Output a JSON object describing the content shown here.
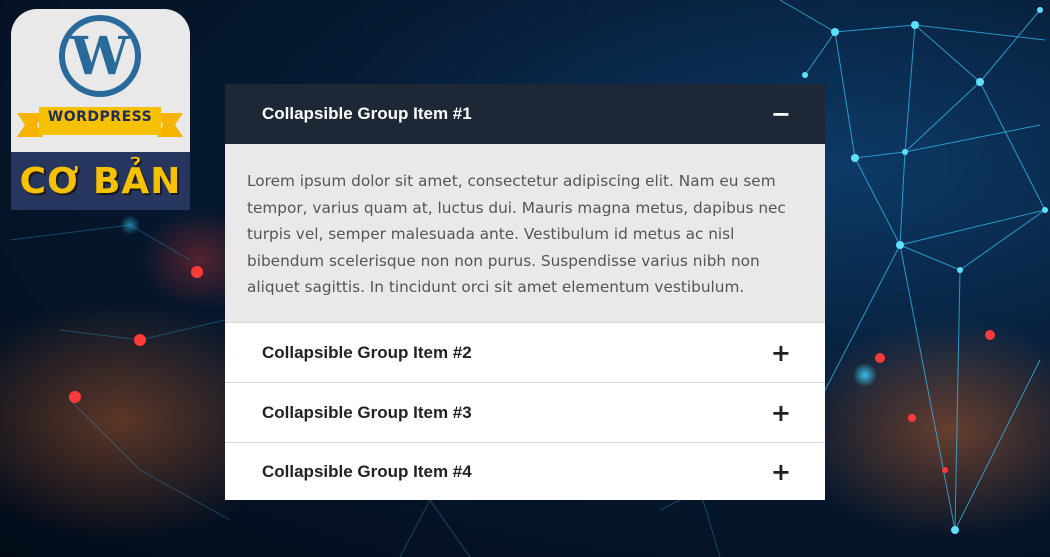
{
  "logo": {
    "brand": "WORDPRESS",
    "wp_letter": "W",
    "subtitle": "CƠ BẢN",
    "colors": {
      "circle": "#2a6a9a",
      "ribbon": "#f6c200",
      "band": "#27365f"
    }
  },
  "accordion": {
    "items": [
      {
        "title": "Collapsible Group Item #1",
        "sign": "−",
        "expanded": true,
        "body": "Lorem ipsum dolor sit amet, consectetur adipiscing elit. Nam eu sem tempor, varius quam at, luctus dui. Mauris magna metus, dapibus nec turpis vel, semper malesuada ante. Vestibulum id metus ac nisl bibendum scelerisque non non purus. Suspendisse varius nibh non aliquet sagittis. In tincidunt orci sit amet elementum vestibulum."
      },
      {
        "title": "Collapsible Group Item #2",
        "sign": "+",
        "expanded": false
      },
      {
        "title": "Collapsible Group Item #3",
        "sign": "+",
        "expanded": false
      },
      {
        "title": "Collapsible Group Item #4",
        "sign": "+",
        "expanded": false
      }
    ],
    "colors": {
      "active_header": "#1e2736",
      "body_bg": "#e9e9e9"
    }
  }
}
